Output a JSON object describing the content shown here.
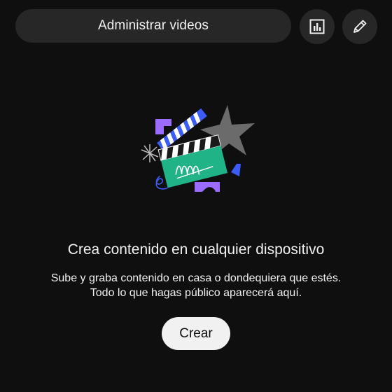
{
  "header": {
    "manage_videos_label": "Administrar videos",
    "analytics_icon": "bar-chart-icon",
    "edit_icon": "pencil-icon"
  },
  "empty_state": {
    "illustration": "clapperboard-illustration",
    "title": "Crea contenido en cualquier dispositivo",
    "description_line1": "Sube y graba contenido en casa o dondequiera que estés.",
    "description_line2": "Todo lo que hagas público aparecerá aquí.",
    "create_label": "Crear"
  },
  "colors": {
    "background": "#0f0f0f",
    "button_bg": "#272727",
    "primary_button_bg": "#f1f1f1",
    "text": "#f1f1f1",
    "accent_teal": "#1fb387",
    "accent_blue": "#3d5bf5",
    "accent_purple": "#9b6cff",
    "star_gray": "#6b6b6b"
  }
}
